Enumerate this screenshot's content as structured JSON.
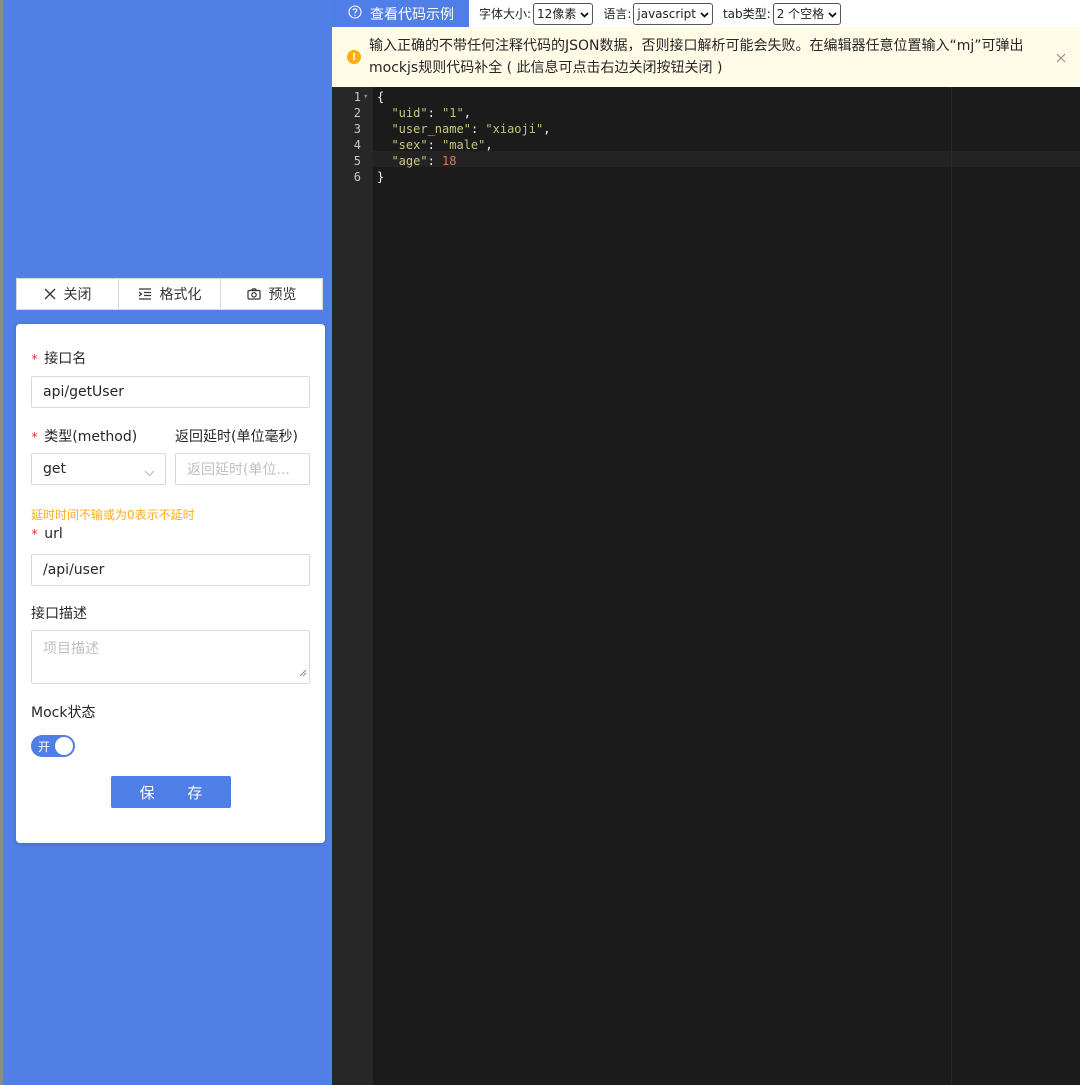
{
  "toolbar": {
    "close_label": "关闭",
    "format_label": "格式化",
    "preview_label": "预览"
  },
  "form": {
    "name_label": "接口名",
    "name_value": "api/getUser",
    "method_label": "类型(method)",
    "method_value": "get",
    "delay_label": "返回延时(单位毫秒)",
    "delay_placeholder": "返回延时(单位...",
    "delay_hint": "延时时间不输或为0表示不延时",
    "url_label": "url",
    "url_value": "/api/user",
    "desc_label": "接口描述",
    "desc_placeholder": "项目描述",
    "mock_label": "Mock状态",
    "mock_switch_text": "开",
    "mock_enabled": true,
    "save_label": "保 存"
  },
  "topbar": {
    "demo_label": "查看代码示例",
    "font_size_label": "字体大小:",
    "font_size_value": "12像素",
    "language_label": "语言:",
    "language_value": "javascript",
    "tab_type_label": "tab类型:",
    "tab_type_value": "2 个空格"
  },
  "alert": {
    "message": "输入正确的不带任何注释代码的JSON数据，否则接口解析可能会失败。在编辑器任意位置输入“mj”可弹出mockjs规则代码补全 ( 此信息可点击右边关闭按钮关闭 )"
  },
  "editor": {
    "line_numbers": [
      "1",
      "2",
      "3",
      "4",
      "5",
      "6"
    ],
    "lines": [
      {
        "k": "",
        "v": "{"
      },
      {
        "k": "\"uid\"",
        "sep": ": ",
        "v": "\"1\"",
        "end": ","
      },
      {
        "k": "\"user_name\"",
        "sep": ": ",
        "v": "\"xiaoji\"",
        "end": ","
      },
      {
        "k": "\"sex\"",
        "sep": ": ",
        "v": "\"male\"",
        "end": ","
      },
      {
        "k": "\"age\"",
        "sep": ": ",
        "v": "18",
        "end": ""
      },
      {
        "k": "",
        "v": "}"
      }
    ]
  },
  "colors": {
    "brand": "#4f7ee6",
    "warning": "#faad14",
    "required": "#f5222d",
    "editor_bg": "#1b1b1b"
  }
}
